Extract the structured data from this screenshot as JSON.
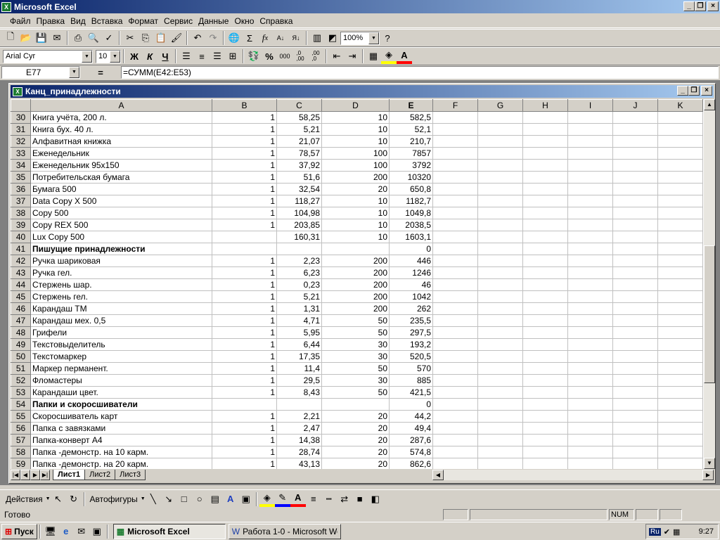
{
  "app": {
    "title": "Microsoft Excel"
  },
  "menu": [
    "Файл",
    "Правка",
    "Вид",
    "Вставка",
    "Формат",
    "Сервис",
    "Данные",
    "Окно",
    "Справка"
  ],
  "toolbar": {
    "zoom": "100%",
    "font": "Arial Cyr",
    "size": "10",
    "bold": "Ж",
    "italic": "К",
    "underline": "Ч",
    "percent": "%",
    "thousands": "000",
    "inc_dec": ",0\n,00",
    "dec_dec": ",00\n,0"
  },
  "formula": {
    "cell": "E77",
    "eq": "=",
    "content": "=СУММ(E42:E53)"
  },
  "workbook": {
    "title": "Канц_принадлежности"
  },
  "columns": [
    "A",
    "B",
    "C",
    "D",
    "E",
    "F",
    "G",
    "H",
    "I",
    "J",
    "K"
  ],
  "rows": [
    {
      "n": "30",
      "a": "Книга учёта, 200 л.",
      "b": "1",
      "c": "58,25",
      "d": "10",
      "e": "582,5"
    },
    {
      "n": "31",
      "a": "Книга бух. 40 л.",
      "b": "1",
      "c": "5,21",
      "d": "10",
      "e": "52,1"
    },
    {
      "n": "32",
      "a": "Алфавитная книжка",
      "b": "1",
      "c": "21,07",
      "d": "10",
      "e": "210,7"
    },
    {
      "n": "33",
      "a": "Еженедельник",
      "b": "1",
      "c": "78,57",
      "d": "100",
      "e": "7857"
    },
    {
      "n": "34",
      "a": "Еженедельник 95х150",
      "b": "1",
      "c": "37,92",
      "d": "100",
      "e": "3792"
    },
    {
      "n": "35",
      "a": "Потребительская бумага",
      "b": "1",
      "c": "51,6",
      "d": "200",
      "e": "10320"
    },
    {
      "n": "36",
      "a": "Бумага 500",
      "b": "1",
      "c": "32,54",
      "d": "20",
      "e": "650,8"
    },
    {
      "n": "37",
      "a": "Data Copy X 500",
      "b": "1",
      "c": "118,27",
      "d": "10",
      "e": "1182,7"
    },
    {
      "n": "38",
      "a": "Copy  500",
      "b": "1",
      "c": "104,98",
      "d": "10",
      "e": "1049,8"
    },
    {
      "n": "39",
      "a": "Copy REX 500",
      "b": "1",
      "c": "203,85",
      "d": "10",
      "e": "2038,5"
    },
    {
      "n": "40",
      "a": "Lux  Copy 500",
      "b": "",
      "c": "160,31",
      "d": "10",
      "e": "1603,1"
    },
    {
      "n": "41",
      "a": "Пишущие принадлежности",
      "b": "",
      "c": "",
      "d": "",
      "e": "0",
      "bold": true
    },
    {
      "n": "42",
      "a": "Ручка шариковая",
      "b": "1",
      "c": "2,23",
      "d": "200",
      "e": "446"
    },
    {
      "n": "43",
      "a": "Ручка гел.",
      "b": "1",
      "c": "6,23",
      "d": "200",
      "e": "1246"
    },
    {
      "n": "44",
      "a": "Стержень шар.",
      "b": "1",
      "c": "0,23",
      "d": "200",
      "e": "46"
    },
    {
      "n": "45",
      "a": "Стержень гел.",
      "b": "1",
      "c": "5,21",
      "d": "200",
      "e": "1042"
    },
    {
      "n": "46",
      "a": "Карандаш ТМ",
      "b": "1",
      "c": "1,31",
      "d": "200",
      "e": "262"
    },
    {
      "n": "47",
      "a": "Карандаш мех. 0,5",
      "b": "1",
      "c": "4,71",
      "d": "50",
      "e": "235,5"
    },
    {
      "n": "48",
      "a": "Грифели",
      "b": "1",
      "c": "5,95",
      "d": "50",
      "e": "297,5"
    },
    {
      "n": "49",
      "a": "Текстовыделитель",
      "b": "1",
      "c": "6,44",
      "d": "30",
      "e": "193,2"
    },
    {
      "n": "50",
      "a": "Текстомаркер",
      "b": "1",
      "c": "17,35",
      "d": "30",
      "e": "520,5"
    },
    {
      "n": "51",
      "a": "Маркер перманент.",
      "b": "1",
      "c": "11,4",
      "d": "50",
      "e": "570"
    },
    {
      "n": "52",
      "a": "Фломастеры",
      "b": "1",
      "c": "29,5",
      "d": "30",
      "e": "885"
    },
    {
      "n": "53",
      "a": "Карандаши цвет.",
      "b": "1",
      "c": "8,43",
      "d": "50",
      "e": "421,5"
    },
    {
      "n": "54",
      "a": "Папки и скоросшиватели",
      "b": "",
      "c": "",
      "d": "",
      "e": "0",
      "bold": true
    },
    {
      "n": "55",
      "a": "Скоросшиватель карт",
      "b": "1",
      "c": "2,21",
      "d": "20",
      "e": "44,2"
    },
    {
      "n": "56",
      "a": "Папка с завязками",
      "b": "1",
      "c": "2,47",
      "d": "20",
      "e": "49,4"
    },
    {
      "n": "57",
      "a": "Папка-конверт А4",
      "b": "1",
      "c": "14,38",
      "d": "20",
      "e": "287,6"
    },
    {
      "n": "58",
      "a": "Папка -демонстр. на 10 карм.",
      "b": "1",
      "c": "28,74",
      "d": "20",
      "e": "574,8"
    },
    {
      "n": "59",
      "a": "Папка -демонстр. на 20 карм.",
      "b": "1",
      "c": "43,13",
      "d": "20",
      "e": "862,6"
    }
  ],
  "sheets": [
    "Лист1",
    "Лист2",
    "Лист3"
  ],
  "drawing": {
    "actions": "Действия",
    "autoshapes": "Автофигуры"
  },
  "status": {
    "ready": "Готово",
    "num": "NUM"
  },
  "taskbar": {
    "start": "Пуск",
    "task1": "Microsoft Excel",
    "task2": "Работа 1-0 - Microsoft Word",
    "lang": "Ru",
    "time": "9:27"
  }
}
